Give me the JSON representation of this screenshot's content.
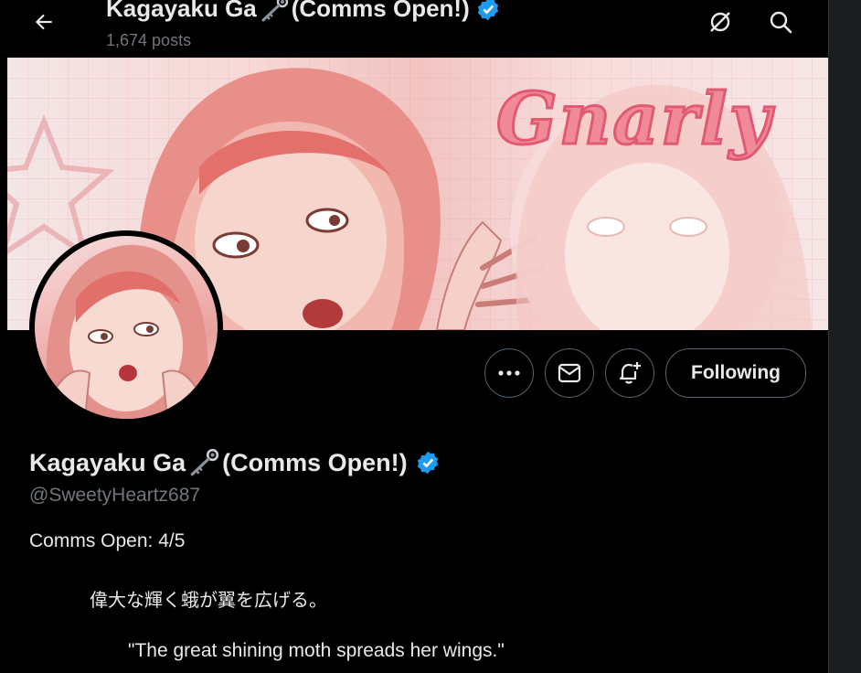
{
  "header": {
    "title": "Kagayaku Ga",
    "title_suffix": "(Comms Open!)",
    "post_count": "1,674 posts"
  },
  "banner": {
    "logo_text": "Gnarly"
  },
  "actions": {
    "more_icon": "ellipsis-icon",
    "message_icon": "envelope-icon",
    "notify_icon": "bell-plus-icon",
    "following_label": "Following"
  },
  "profile": {
    "name": "Kagayaku Ga",
    "name_suffix": "(Comms Open!)",
    "handle": "@SweetyHeartz687",
    "bio": [
      "Comms Open: 4/5",
      "偉大な輝く蛾が翼を広げる。",
      "\"The great shining moth spreads her wings.\""
    ]
  },
  "colors": {
    "background": "#000000",
    "text": "#e7e9ea",
    "muted": "#71767b",
    "verified": "#1d9bf0",
    "border": "#536471"
  }
}
